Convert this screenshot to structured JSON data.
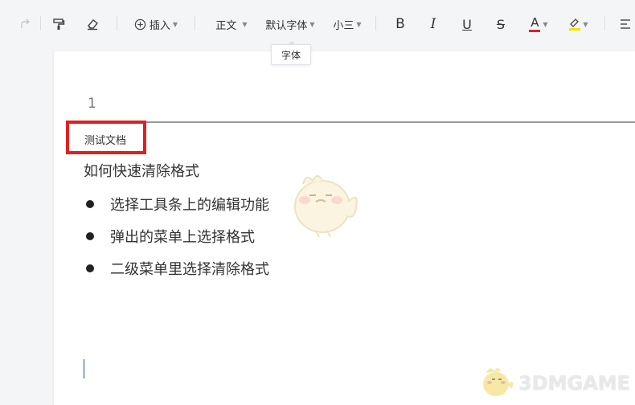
{
  "toolbar": {
    "insert_label": "插入",
    "paragraph_style": "正文",
    "font_name": "默认字体",
    "font_size": "小三",
    "bold_label": "B",
    "italic_label": "I",
    "underline_label": "U",
    "strike_label": "S",
    "font_color_label": "A",
    "font_color": "#e02020",
    "highlight_color": "#f5e300"
  },
  "tooltip": {
    "text": "字体"
  },
  "document": {
    "page_number": "1",
    "header_text": "测试文档",
    "title": "如何快速清除格式",
    "bullets": [
      "选择工具条上的编辑功能",
      "弹出的菜单上选择格式",
      "二级菜单里选择清除格式"
    ]
  },
  "watermark": {
    "text": "3DMGAME"
  }
}
